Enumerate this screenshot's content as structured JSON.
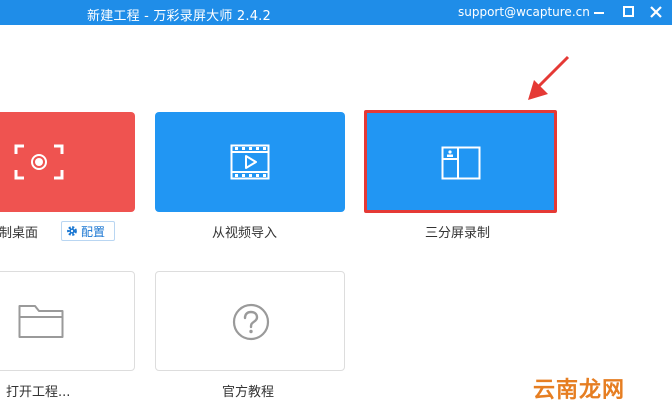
{
  "window": {
    "title": "新建工程 - 万彩录屏大师 2.4.2",
    "email": "support@wcapture.cn"
  },
  "cards": {
    "desktop": {
      "label": "录制桌面",
      "config_label": "配置",
      "color": "#ef5350",
      "icon": "record-screen-icon"
    },
    "video_import": {
      "label": "从视频导入",
      "color": "#2196f3",
      "icon": "video-film-icon"
    },
    "split_screen": {
      "label": "三分屏录制",
      "color": "#2196f3",
      "highlight": "#e53935",
      "icon": "split-layout-icon"
    },
    "open_project": {
      "label": "打开工程...",
      "icon": "folder-icon"
    },
    "tutorial": {
      "label": "官方教程",
      "icon": "question-icon"
    }
  },
  "watermark": "云南龙网"
}
